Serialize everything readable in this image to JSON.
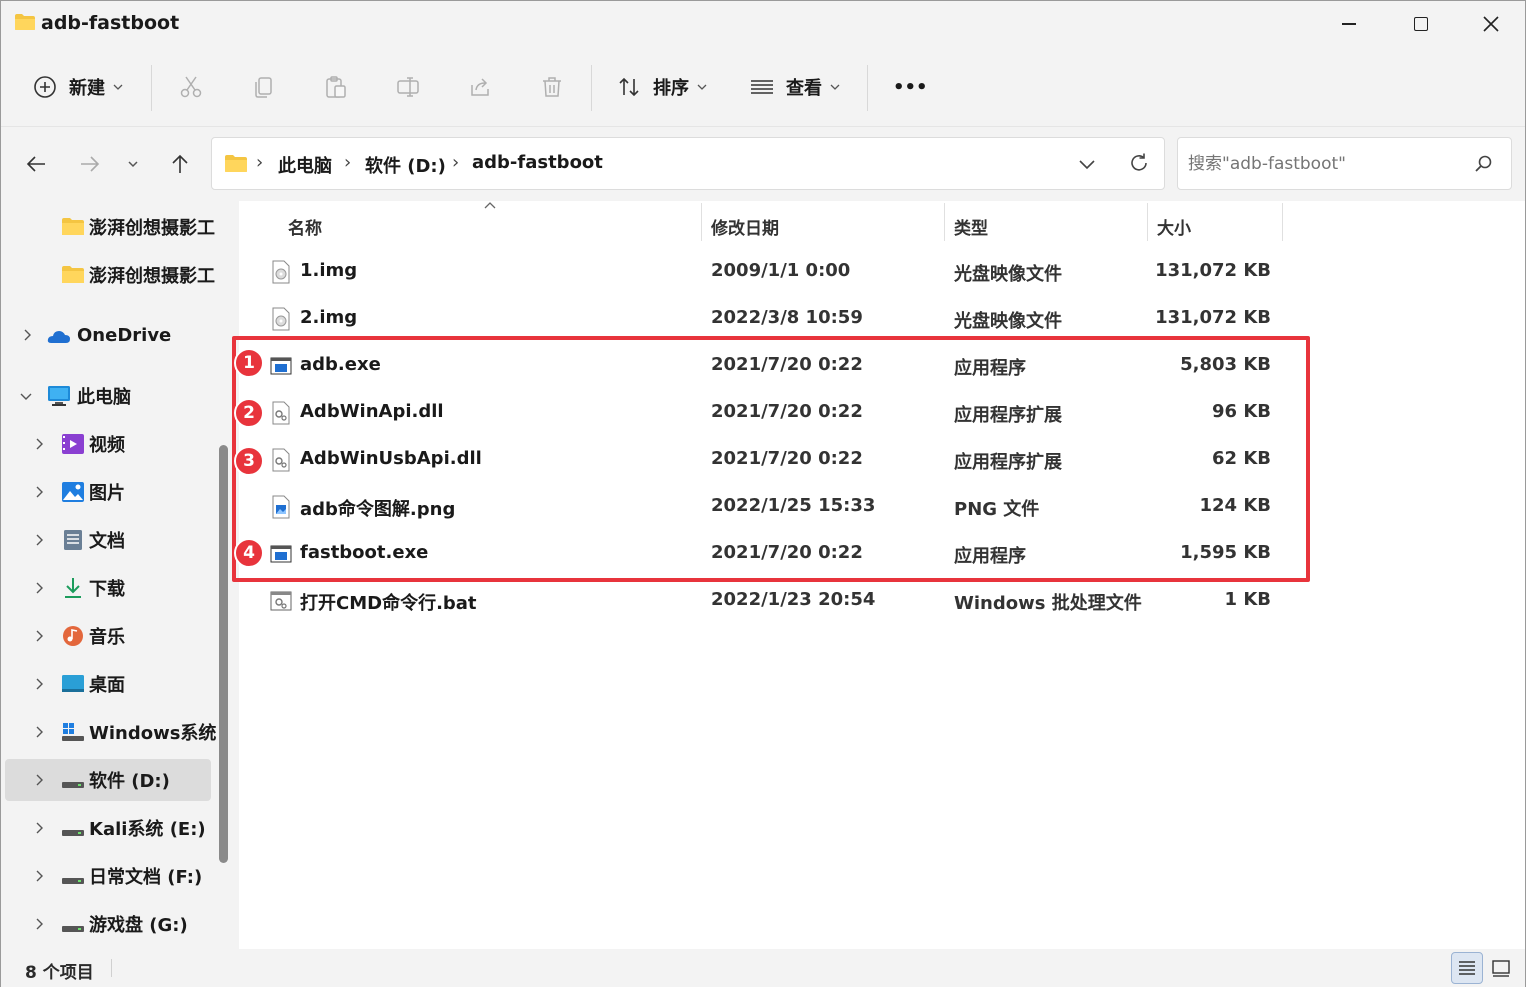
{
  "window": {
    "title": "adb-fastboot"
  },
  "toolbar": {
    "new_label": "新建",
    "sort_label": "排序",
    "view_label": "查看",
    "more_label": "•••"
  },
  "address": {
    "crumbs": [
      "此电脑",
      "软件 (D:)",
      "adb-fastboot"
    ],
    "search_placeholder": "搜索\"adb-fastboot\""
  },
  "sidebar": {
    "items": [
      {
        "label": "澎湃创想摄影工",
        "icon": "folder-icon"
      },
      {
        "label": "澎湃创想摄影工",
        "icon": "folder-icon"
      },
      {
        "label": "OneDrive",
        "icon": "onedrive-icon"
      },
      {
        "label": "此电脑",
        "icon": "computer-icon"
      },
      {
        "label": "视频",
        "icon": "video-icon"
      },
      {
        "label": "图片",
        "icon": "pictures-icon"
      },
      {
        "label": "文档",
        "icon": "documents-icon"
      },
      {
        "label": "下载",
        "icon": "download-icon"
      },
      {
        "label": "音乐",
        "icon": "music-icon"
      },
      {
        "label": "桌面",
        "icon": "desktop-icon"
      },
      {
        "label": "Windows系统",
        "icon": "windows-drive-icon"
      },
      {
        "label": "软件 (D:)",
        "icon": "drive-icon"
      },
      {
        "label": "Kali系统 (E:)",
        "icon": "drive-icon"
      },
      {
        "label": "日常文档 (F:)",
        "icon": "drive-icon"
      },
      {
        "label": "游戏盘 (G:)",
        "icon": "drive-icon"
      }
    ]
  },
  "columns": {
    "name": "名称",
    "date": "修改日期",
    "type": "类型",
    "size": "大小"
  },
  "files": [
    {
      "name": "1.img",
      "date": "2009/1/1 0:00",
      "type": "光盘映像文件",
      "size": "131,072 KB",
      "icon": "disc-image-icon"
    },
    {
      "name": "2.img",
      "date": "2022/3/8 10:59",
      "type": "光盘映像文件",
      "size": "131,072 KB",
      "icon": "disc-image-icon"
    },
    {
      "name": "adb.exe",
      "date": "2021/7/20 0:22",
      "type": "应用程序",
      "size": "5,803 KB",
      "icon": "exe-icon"
    },
    {
      "name": "AdbWinApi.dll",
      "date": "2021/7/20 0:22",
      "type": "应用程序扩展",
      "size": "96 KB",
      "icon": "dll-icon"
    },
    {
      "name": "AdbWinUsbApi.dll",
      "date": "2021/7/20 0:22",
      "type": "应用程序扩展",
      "size": "62 KB",
      "icon": "dll-icon"
    },
    {
      "name": "adb命令图解.png",
      "date": "2022/1/25 15:33",
      "type": "PNG 文件",
      "size": "124 KB",
      "icon": "png-icon"
    },
    {
      "name": "fastboot.exe",
      "date": "2021/7/20 0:22",
      "type": "应用程序",
      "size": "1,595 KB",
      "icon": "exe-icon"
    },
    {
      "name": "打开CMD命令行.bat",
      "date": "2022/1/23 20:54",
      "type": "Windows 批处理文件",
      "size": "1 KB",
      "icon": "bat-icon"
    }
  ],
  "annotations": {
    "badges": [
      "1",
      "2",
      "3",
      "4"
    ],
    "color": "#e8343c"
  },
  "status": {
    "item_count": "8 个项目"
  }
}
